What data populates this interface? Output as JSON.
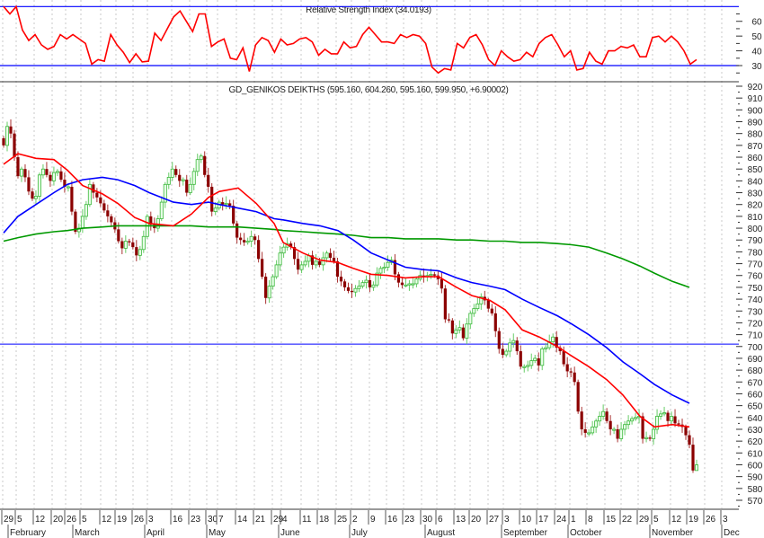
{
  "chart_data": [
    {
      "type": "line",
      "title": "Relative Strength Index (34.0193)",
      "ylim": [
        22,
        72
      ],
      "y_ticks": [
        60,
        50,
        40,
        30
      ],
      "reference_lines": [
        70,
        30
      ],
      "grid": "vertical dotted",
      "colors": {
        "rsi": "#ff0000",
        "reference": "#0000ff"
      },
      "rsi": [
        70,
        65,
        70,
        54,
        47,
        51,
        44,
        41,
        43,
        51,
        48,
        51,
        48,
        45,
        31,
        34,
        33,
        51,
        44,
        39,
        32,
        38,
        32.5,
        33,
        52,
        47,
        55,
        63,
        67,
        60,
        53,
        65,
        65,
        43,
        46,
        48,
        35,
        34,
        42,
        26,
        44,
        49,
        47,
        39,
        48,
        44,
        45,
        48,
        49,
        46,
        37,
        41,
        38,
        38,
        46,
        42,
        43,
        51,
        56,
        51,
        46,
        46,
        45,
        51,
        49,
        51,
        50,
        45,
        29,
        25,
        28,
        27,
        45,
        42,
        49,
        51,
        44,
        34,
        30,
        40,
        36,
        33,
        34,
        39,
        36,
        45,
        49,
        51,
        44,
        36,
        40,
        27,
        28,
        39,
        33,
        31,
        40,
        40,
        43,
        42,
        44,
        36,
        36,
        49,
        50,
        46,
        50,
        46,
        40,
        31,
        34.0193
      ]
    },
    {
      "type": "candlestick",
      "title": "GD_GENIKOS DEIKTHS (595.160, 604.260, 595.160, 599.950, +6.90002)",
      "last_bar": {
        "open": 595.16,
        "high": 604.26,
        "low": 595.16,
        "close": 599.95,
        "change": 6.90002
      },
      "ylim": [
        565,
        925
      ],
      "y_ticks": [
        920,
        910,
        900,
        890,
        880,
        870,
        860,
        850,
        840,
        830,
        820,
        810,
        800,
        790,
        780,
        770,
        760,
        750,
        740,
        730,
        720,
        710,
        700,
        690,
        680,
        670,
        660,
        650,
        640,
        630,
        620,
        610,
        600,
        590,
        580,
        570
      ],
      "horizontal_line": 702,
      "grid": "vertical dotted",
      "colors": {
        "up": "#3cb83c",
        "down": "#8b0000",
        "ma_fast": "#ff0000",
        "ma_mid": "#0000ff",
        "ma_slow": "#009900",
        "hline": "#0000ff"
      },
      "closes": [
        870,
        886,
        880,
        860,
        844,
        850,
        843,
        831,
        825,
        827,
        845,
        850,
        845,
        840,
        847,
        848,
        841,
        835,
        835,
        814,
        797,
        800,
        810,
        820,
        837,
        830,
        826,
        821,
        815,
        810,
        805,
        799,
        789,
        783,
        789,
        788,
        784,
        777,
        782,
        793,
        810,
        803,
        800,
        808,
        822,
        837,
        843,
        850,
        845,
        840,
        841,
        830,
        837,
        848,
        858,
        861,
        845,
        835,
        814,
        817,
        822,
        820,
        821,
        819,
        804,
        792,
        790,
        788,
        789,
        793,
        790,
        774,
        759,
        741,
        751,
        759,
        769,
        779,
        784,
        787,
        784,
        774,
        765,
        769,
        772,
        777,
        769,
        772,
        769,
        775,
        779,
        775,
        772,
        759,
        755,
        750,
        747,
        746,
        749,
        751,
        754,
        756,
        750,
        752,
        762,
        766,
        767,
        771,
        773,
        761,
        754,
        752,
        752,
        753,
        753,
        757,
        760,
        759,
        760,
        761,
        760,
        757,
        749,
        723,
        722,
        711,
        714,
        716,
        707,
        719,
        728,
        732,
        736,
        742,
        739,
        732,
        728,
        713,
        698,
        693,
        696,
        703,
        705,
        696,
        683,
        683,
        684,
        688,
        690,
        684,
        698,
        699,
        704,
        708,
        699,
        696,
        685,
        679,
        678,
        670,
        645,
        630,
        627,
        627,
        632,
        637,
        641,
        645,
        637,
        630,
        630,
        622,
        630,
        634,
        637,
        639,
        640,
        641,
        622,
        623,
        622,
        630,
        641,
        643,
        644,
        637,
        641,
        635,
        634,
        632,
        625,
        617,
        595.16,
        599.95
      ],
      "ma_at_ticks": {
        "fast": [
          854,
          863,
          859,
          858,
          849,
          836,
          829,
          821,
          809,
          804,
          802,
          812,
          826,
          831,
          834,
          821,
          804,
          788,
          779,
          773,
          771,
          766,
          761,
          760,
          758,
          759,
          759,
          750,
          743,
          739,
          731,
          714,
          708,
          700,
          692,
          683,
          672,
          659,
          641,
          632,
          634,
          632,
          null,
          null
        ],
        "mid": [
          796,
          810,
          820,
          830,
          837,
          841,
          843,
          841,
          836,
          830,
          822,
          820,
          822,
          820,
          817,
          814,
          808,
          807,
          804,
          802,
          798,
          790,
          779,
          773,
          767,
          765,
          764,
          758,
          754,
          751,
          748,
          740,
          733,
          726,
          719,
          710,
          699,
          687,
          677,
          668,
          659,
          652,
          null,
          null
        ],
        "slow": [
          789,
          792,
          795,
          797,
          798,
          800,
          801,
          802,
          802,
          802,
          802,
          802,
          801,
          801,
          801,
          800,
          799,
          798,
          797,
          796,
          795,
          794,
          792,
          792,
          791,
          791,
          791,
          790,
          790,
          789,
          789,
          788,
          788,
          787,
          786,
          784,
          779,
          774,
          768,
          762,
          755,
          750,
          null,
          null
        ]
      }
    }
  ],
  "x_axis": {
    "day_ticks": [
      "29",
      "5",
      "12",
      "20",
      "26",
      "5",
      "12",
      "19",
      "26",
      "3",
      "16",
      "23",
      "30",
      "7",
      "14",
      "21",
      "29",
      "4",
      "11",
      "18",
      "25",
      "2",
      "9",
      "16",
      "23",
      "30",
      "6",
      "13",
      "20",
      "27",
      "3",
      "10",
      "17",
      "24",
      "1",
      "8",
      "15",
      "22",
      "29",
      "5",
      "12",
      "19",
      "26",
      "3"
    ],
    "months": [
      "February",
      "March",
      "April",
      "May",
      "June",
      "July",
      "August",
      "September",
      "October",
      "November",
      "Dec"
    ]
  }
}
